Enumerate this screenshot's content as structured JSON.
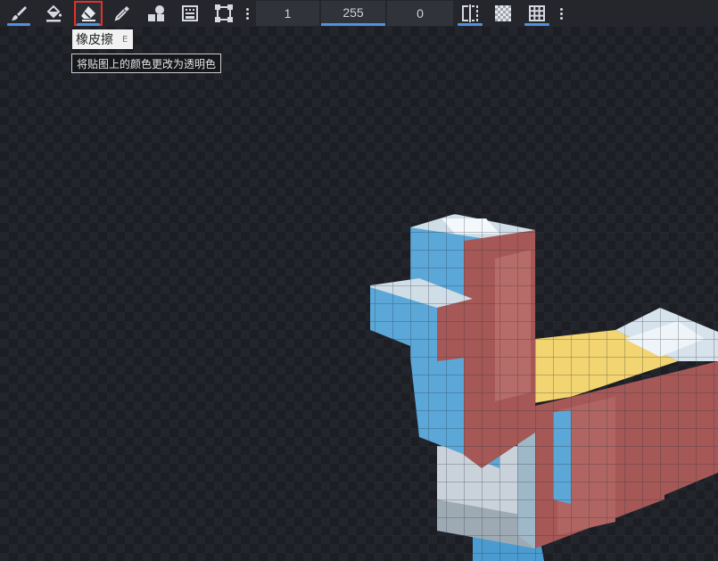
{
  "toolbar": {
    "tools": [
      {
        "name": "brush-tool",
        "icon": "paintbrush-icon"
      },
      {
        "name": "fill-tool",
        "icon": "paint-bucket-icon"
      },
      {
        "name": "eraser-tool",
        "icon": "eraser-icon",
        "selected": true
      },
      {
        "name": "color-picker-tool",
        "icon": "eyedropper-icon"
      },
      {
        "name": "shapes-tool",
        "icon": "shapes-icon"
      },
      {
        "name": "gradient-tool",
        "icon": "gradient-icon"
      },
      {
        "name": "selection-tool",
        "icon": "transform-select-icon"
      }
    ],
    "brush_size": "1",
    "opacity": "255",
    "softness": "0"
  },
  "tooltip": {
    "title": "橡皮擦",
    "shortcut": "E",
    "description": "将贴图上的颜色更改为透明色"
  },
  "colors": {
    "accent": "#4f93e0",
    "selected_outline": "#e1322a",
    "model_blue": "#58a6d6",
    "model_red": "#a85a58",
    "model_yellow": "#f3d46b",
    "model_white": "#d6e2ea"
  }
}
